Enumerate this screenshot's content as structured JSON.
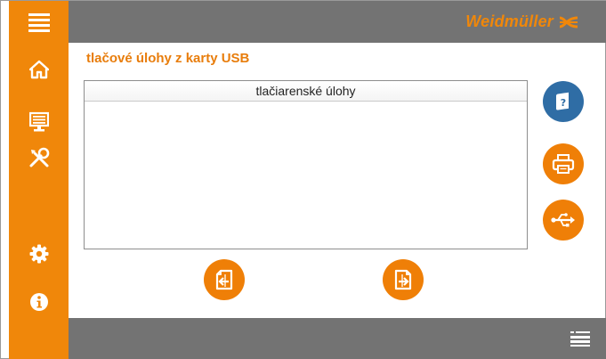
{
  "header": {
    "brand_name": "Weidmüller",
    "brand_logo_icon": "weidmuller-cross-logo"
  },
  "sidebar": {
    "items": [
      {
        "name": "menu",
        "icon": "hamburger-menu-icon"
      },
      {
        "name": "home",
        "icon": "home-icon"
      },
      {
        "name": "monitor",
        "icon": "monitor-icon"
      },
      {
        "name": "tools",
        "icon": "tools-icon"
      },
      {
        "name": "settings",
        "icon": "gear-icon"
      },
      {
        "name": "info",
        "icon": "info-icon"
      }
    ]
  },
  "main": {
    "title": "tlačové úlohy z karty USB",
    "table": {
      "header": "tlačiarenské úlohy",
      "rows": []
    },
    "right_actions": [
      {
        "name": "help",
        "icon": "help-book-icon",
        "color": "#2f6da5"
      },
      {
        "name": "print",
        "icon": "printer-icon",
        "color": "#ef7f07"
      },
      {
        "name": "usb",
        "icon": "usb-icon",
        "color": "#ef7f07"
      }
    ],
    "bottom_actions": [
      {
        "name": "import",
        "icon": "document-import-icon"
      },
      {
        "name": "export",
        "icon": "document-export-icon"
      }
    ]
  },
  "footer": {
    "list_icon": "list-view-icon"
  },
  "colors": {
    "accent": "#f0870a",
    "bar": "#737373",
    "help_blue": "#2f6da5"
  }
}
